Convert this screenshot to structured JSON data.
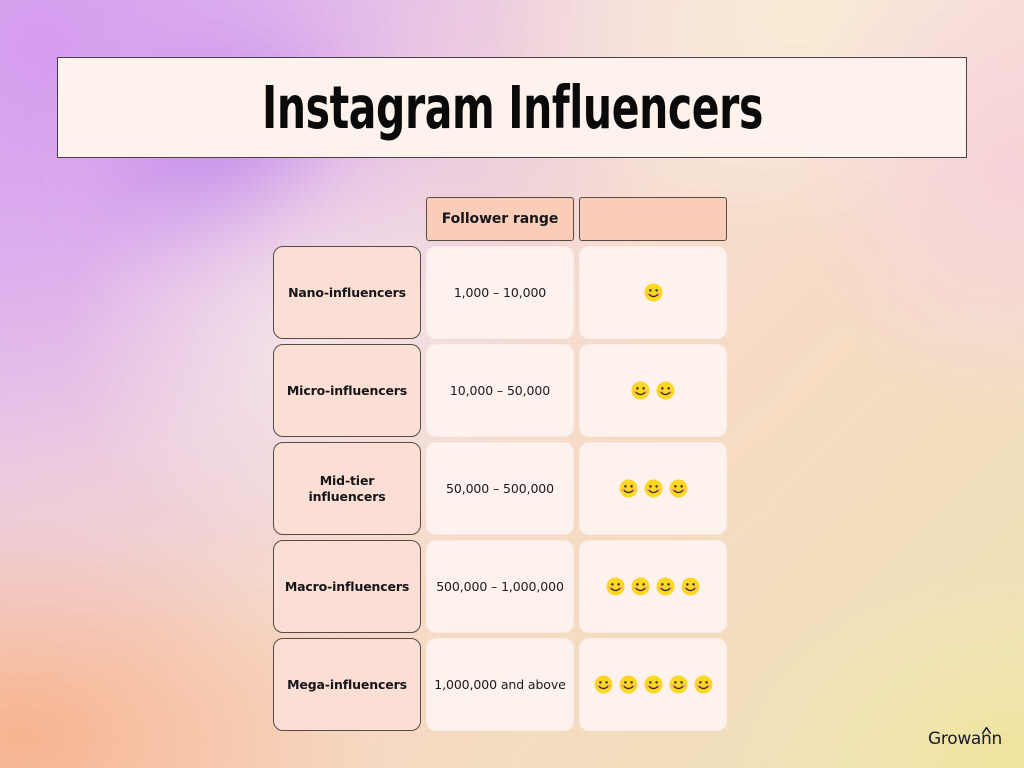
{
  "title": {
    "text": "Instagram Influencers"
  },
  "table": {
    "headers": {
      "label_column": "",
      "follower_range": "Follower range",
      "rating_column": ""
    },
    "rows": [
      {
        "tier": "Nano-influencers",
        "follower_range": "1,000 – 10,000",
        "rating_count": 1,
        "rating_icon": "smiley-face-icon"
      },
      {
        "tier": "Micro-influencers",
        "follower_range": "10,000 – 50,000",
        "rating_count": 2,
        "rating_icon": "smiley-face-icon"
      },
      {
        "tier": "Mid-tier influencers",
        "follower_range": "50,000 – 500,000",
        "rating_count": 3,
        "rating_icon": "smiley-face-icon"
      },
      {
        "tier": "Macro-influencers",
        "follower_range": "500,000 – 1,000,000",
        "rating_count": 4,
        "rating_icon": "smiley-face-icon"
      },
      {
        "tier": "Mega-influencers",
        "follower_range": "1,000,000 and above",
        "rating_count": 5,
        "rating_icon": "smiley-face-icon"
      }
    ]
  },
  "logo": {
    "text": "Growann"
  },
  "colors": {
    "title_box_fill": "#fdf2ec",
    "title_box_border": "#4a3f44",
    "header_cell_fill": "#f9cdb8",
    "label_cell_fill": "#fbdfd4",
    "data_cell_fill": "#fdf2ed",
    "cell_border": "#584a46",
    "text_dark": "#15151a",
    "smiley_yellow": "#fcd724",
    "smiley_blush": "#f79aa0",
    "logo_navy": "#171a2e",
    "bg_purple": "#e0a6f3",
    "bg_peach": "#fcb792",
    "bg_cream": "#fff1db",
    "bg_yellow": "#f5e8a0"
  }
}
